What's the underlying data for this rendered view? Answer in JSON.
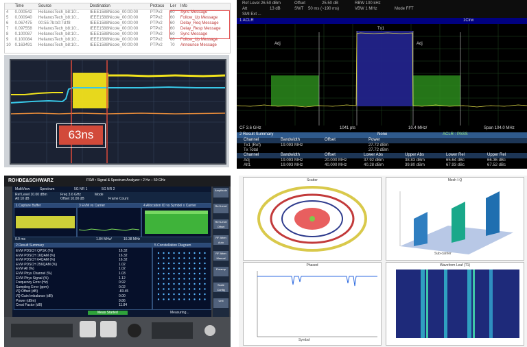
{
  "capture": {
    "columns": [
      "Time",
      "Source",
      "Destination",
      "Protoco",
      "Ler",
      "Info"
    ],
    "rows": [
      {
        "no": "4",
        "time": "0.000542",
        "source": "HellanosTech_b8:10:..",
        "dest": "IEEE1588Nicole_00:00:00",
        "proto": "PTPv2",
        "len": "60",
        "info": "Sync Message"
      },
      {
        "no": "5",
        "time": "0.000940",
        "source": "HellanosTech_b8:10:..",
        "dest": "IEEE1588Nicole_00:00:00",
        "proto": "PTPv2",
        "len": "60",
        "info": "Follow_Up Message"
      },
      {
        "no": "6",
        "time": "0.067475",
        "source": "00:55:7b:b0:7d:f8",
        "dest": "IEEE1588Nicole_00:00:00",
        "proto": "PTPv2",
        "len": "60",
        "info": "Delay_Req Message"
      },
      {
        "no": "7",
        "time": "0.097558",
        "source": "HellanosTech_b8:10:..",
        "dest": "IEEE1588Nicole_00:00:00",
        "proto": "PTPv2",
        "len": "60",
        "info": "Delay_Resp Message"
      },
      {
        "no": "8",
        "time": "0.100087",
        "source": "HellanosTech_b8:10:..",
        "dest": "IEEE1588Nicole_00:00:00",
        "proto": "PTPv2",
        "len": "60",
        "info": "Sync Message"
      },
      {
        "no": "9",
        "time": "0.100084",
        "source": "HellanosTech_b8:10:..",
        "dest": "IEEE1588Nicole_00:00:00",
        "proto": "PTPv2",
        "len": "60",
        "info": "Follow_Up Message"
      },
      {
        "no": "10",
        "time": "0.163491",
        "source": "HellanosTech_b8:10:..",
        "dest": "IEEE1588Nicole_00:00:00",
        "proto": "PTPv2",
        "len": "70",
        "info": "Announce Message"
      }
    ]
  },
  "scope": {
    "measurement_label": "63ns",
    "colors": {
      "trace_yellow": "#f2e31c",
      "trace_cyan": "#38c8e8",
      "cursor": "#e04a3a"
    }
  },
  "spectrum": {
    "header": {
      "ref_level": "Ref Level 26.50 dBm",
      "offset": "Offset",
      "offset_value": "25.50 dB",
      "rbw": "RBW 100 kHz",
      "att": "Att",
      "att_value": "13 dB",
      "swt": "SWT",
      "swt_value": "50 ms (~190 ms)",
      "vbw": "VBW 1 MHz",
      "mode": "Mode FFT",
      "marker": "SMI Ext ..."
    },
    "tab_label": "1 ACLR",
    "tab_right": "1Clrw",
    "channel_labels": [
      "Adj",
      "Tx1",
      "Adj"
    ],
    "axis": {
      "cf": "CF 3.6 GHz",
      "pts": "1041 pts",
      "div": "10.4 MHz/",
      "span": "Span 104.0 MHz"
    },
    "summary": {
      "title": "2 Result Summary",
      "noise": "None",
      "aclr_status": "ACLR : PASS",
      "tx_headers": [
        "Channel",
        "Bandwidth",
        "Offset",
        "Power"
      ],
      "tx_rows": [
        {
          "channel": "Tx1 (Ref)",
          "bandwidth": "19.093 MHz",
          "offset": "",
          "power": "27.72 dBm"
        },
        {
          "channel": "Tx Total",
          "bandwidth": "",
          "offset": "",
          "power": "27.72 dBm"
        }
      ],
      "adj_headers": [
        "Channel",
        "Bandwidth",
        "Offset",
        "Lower Abs",
        "Upper Abs",
        "Lower Rel",
        "Upper Rel"
      ],
      "adj_rows": [
        {
          "channel": "Adj",
          "bandwidth": "19.093 MHz",
          "offset": "20.000 MHz",
          "lower_abs": "37.92 dBm",
          "upper_abs": "38.83 dBm",
          "lower_rel": "65.64 dBc",
          "upper_rel": "66.36 dBc"
        },
        {
          "channel": "Alt1",
          "bandwidth": "19.093 MHz",
          "offset": "40.000 MHz",
          "lower_abs": "40.28 dBm",
          "upper_abs": "39.80 dBm",
          "lower_rel": "67.93 dBc",
          "upper_rel": "67.52 dBc"
        }
      ]
    }
  },
  "fsw": {
    "brand": "ROHDE&SCHWARZ",
    "model": "FSW • Signal & Spectrum Analyzer • 2 Hz – 50 GHz",
    "tabs": [
      "MultiView",
      "Spectrum",
      "5G NR 1",
      "5G NR 2"
    ],
    "settings": {
      "ref_level": "Ref Level 10.00 dBm",
      "freq": "Freq 3.6 GHz",
      "mode": "Mode",
      "att": "Att 10 dB",
      "offset": "Offset 10.00 dB",
      "frame": "Frame Count"
    },
    "panes": [
      "1 Capture Buffer",
      "3 EVM vs Carrier",
      "4 Allocation ID vs Symbol x Carrier"
    ],
    "axis": {
      "start": "0.0 ms",
      "mid": "1.84 MHz/",
      "end": "16.38 MHz"
    },
    "result_summary_title": "2 Result Summary",
    "constellation_title": "5 Constellation Diagram",
    "result_rows": [
      {
        "label": "EVM PDSCH QPSK (%)",
        "value": "16.32"
      },
      {
        "label": "EVM PDSCH 16QAM (%)",
        "value": "16.32"
      },
      {
        "label": "EVM PDSCH 64QAM (%)",
        "value": "16.32"
      },
      {
        "label": "EVM PDSCH 256QAM (%)",
        "value": "1.02"
      },
      {
        "label": "EVM All (%)",
        "value": "1.02"
      },
      {
        "label": "EVM Phys Channel (%)",
        "value": "1.03"
      },
      {
        "label": "EVM Phys Signal (%)",
        "value": "1.12"
      },
      {
        "label": "Frequency Error (Hz)",
        "value": "0.92"
      },
      {
        "label": "Sampling Error (ppm)",
        "value": "0.02"
      },
      {
        "label": "I/Q Offset (dB)",
        "value": "-83.45"
      },
      {
        "label": "I/Q Gain Imbalance (dB)",
        "value": "0.00"
      },
      {
        "label": "Power (dBm)",
        "value": "9.86"
      },
      {
        "label": "Crest Factor (dB)",
        "value": "11.84"
      }
    ],
    "softkeys": [
      "Amplitude",
      "Ref Level",
      "Ref Level Offset",
      "RF Atten Auto",
      "RF Atten Manual",
      "Preamp",
      "Scale Config",
      "Unit"
    ],
    "status": "Meas Started",
    "status_right": "Measuring..."
  },
  "plots": {
    "titles": [
      "Scatter",
      "Mesh I-Q",
      "Phased",
      "Waveform Leaf (T1)"
    ],
    "labels": {
      "symbol": "Symbol",
      "subcarrier": "Sub-carrier"
    },
    "colors": {
      "ring_outer": "#d9c94b",
      "ring_mid": "#c23a3a",
      "ring_inner": "#2d3a8c",
      "core": "#e02a2a",
      "center": "#7fc94a"
    }
  }
}
